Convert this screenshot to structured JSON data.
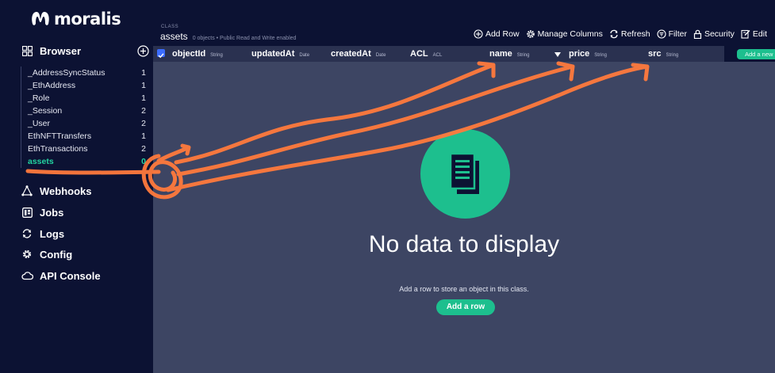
{
  "brand": {
    "name": "moralis",
    "accent": "#23d3a0",
    "button_color": "#1dbf8e",
    "annotation_color": "#ff7a3d"
  },
  "sidebar": {
    "browser": {
      "label": "Browser",
      "icon": "grid-icon"
    },
    "classes": [
      {
        "name": "_AddressSyncStatus",
        "count": "1"
      },
      {
        "name": "_EthAddress",
        "count": "1"
      },
      {
        "name": "_Role",
        "count": "1"
      },
      {
        "name": "_Session",
        "count": "2"
      },
      {
        "name": "_User",
        "count": "2"
      },
      {
        "name": "EthNFTTransfers",
        "count": "1"
      },
      {
        "name": "EthTransactions",
        "count": "2"
      },
      {
        "name": "assets",
        "count": "0",
        "active": true
      }
    ],
    "sections": [
      {
        "label": "Webhooks",
        "icon": "webhook-icon"
      },
      {
        "label": "Jobs",
        "icon": "jobs-icon"
      },
      {
        "label": "Logs",
        "icon": "logs-icon"
      },
      {
        "label": "Config",
        "icon": "gear-icon"
      },
      {
        "label": "API Console",
        "icon": "cloud-icon"
      }
    ]
  },
  "header": {
    "class_label": "CLASS",
    "class_name": "assets",
    "class_meta": "0 objects • Public Read and Write enabled"
  },
  "toolbar": {
    "add_row": "Add Row",
    "manage_columns": "Manage Columns",
    "refresh": "Refresh",
    "filter": "Filter",
    "security": "Security",
    "edit": "Edit"
  },
  "columns": [
    {
      "name": "objectId",
      "type": "String"
    },
    {
      "name": "updatedAt",
      "type": "Date"
    },
    {
      "name": "createdAt",
      "type": "Date"
    },
    {
      "name": "ACL",
      "type": "ACL"
    },
    {
      "name": "name",
      "type": "String"
    },
    {
      "name": "price",
      "type": "String"
    },
    {
      "name": "src",
      "type": "String"
    }
  ],
  "add_new_column": "Add a new",
  "empty_state": {
    "title": "No data to display",
    "description": "Add a row to store an object in this class.",
    "button": "Add a row"
  }
}
